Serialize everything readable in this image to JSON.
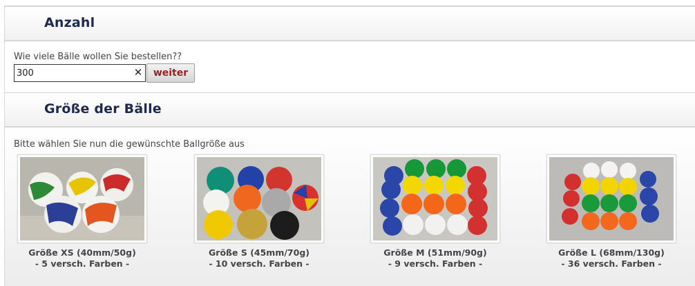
{
  "quantity_section": {
    "title": "Anzahl",
    "question": "Wie viele Bälle wollen Sie bestellen??",
    "input_value": "300",
    "submit_label": "weiter"
  },
  "size_section": {
    "title": "Größe der Bälle",
    "instruction": "Bitte wählen Sie nun die gewünschte Ballgröße aus",
    "options": [
      {
        "title": "Größe XS (40mm/50g)",
        "subtitle": "- 5 versch. Farben -"
      },
      {
        "title": "Größe S (45mm/70g)",
        "subtitle": "- 10 versch. Farben -"
      },
      {
        "title": "Größe M (51mm/90g)",
        "subtitle": "- 9 versch. Farben -"
      },
      {
        "title": "Größe L (68mm/130g)",
        "subtitle": "- 36 versch. Farben -"
      }
    ]
  },
  "colors": {
    "heading": "#1c2a4f",
    "button_text": "#9b2022"
  }
}
